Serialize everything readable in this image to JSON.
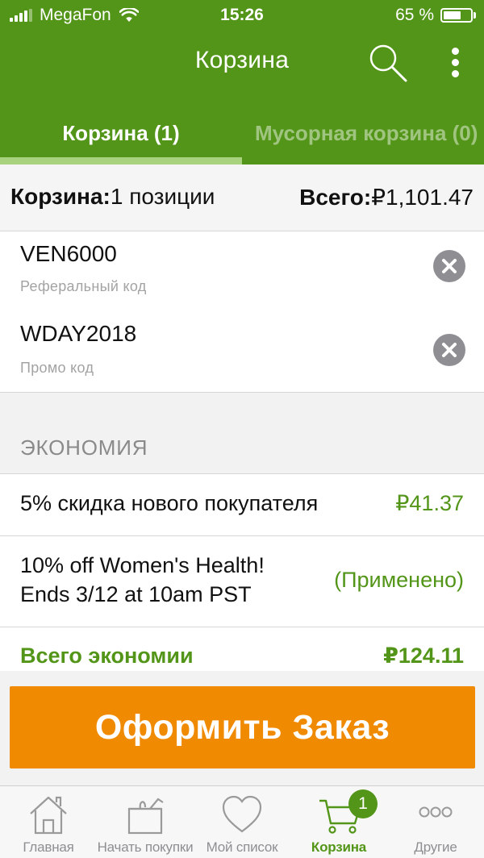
{
  "status_bar": {
    "carrier": "MegaFon",
    "time": "15:26",
    "battery_percent": "65 %",
    "battery_level": 0.65
  },
  "nav": {
    "title": "Корзина"
  },
  "tabs": [
    {
      "label": "Корзина (1)",
      "active": true
    },
    {
      "label": "Мусорная корзина (0)",
      "active": false
    }
  ],
  "summary": {
    "cart_label": "Корзина:",
    "cart_count": "1 позиции",
    "total_label": "Всего:",
    "total_value": "₽1,101.47"
  },
  "codes": [
    {
      "value": "VEN6000",
      "label": "Реферальный код"
    },
    {
      "value": "WDAY2018",
      "label": "Промо код"
    }
  ],
  "savings": {
    "section_title": "ЭКОНОМИЯ",
    "items": [
      {
        "label": "5% скидка нового покупателя",
        "value": "₽41.37"
      },
      {
        "label_line1": "10% off Women's Health!",
        "label_line2": "Ends 3/12 at 10am PST",
        "value": "(Применено)"
      }
    ],
    "total_label": "Всего экономии",
    "total_value": "₽124.11"
  },
  "checkout": {
    "label": "Оформить Заказ"
  },
  "tabbar": {
    "items": [
      {
        "label": "Главная",
        "icon": "home-icon"
      },
      {
        "label": "Начать покупки",
        "icon": "gift-icon"
      },
      {
        "label": "Мой список",
        "icon": "heart-icon"
      },
      {
        "label": "Корзина",
        "icon": "cart-icon",
        "active": true
      },
      {
        "label": "Другие",
        "icon": "more-icon"
      }
    ],
    "cart_badge": "1"
  },
  "colors": {
    "brand_green": "#539518",
    "accent_orange": "#f08a00",
    "tab_indicator": "#a9d27e"
  }
}
